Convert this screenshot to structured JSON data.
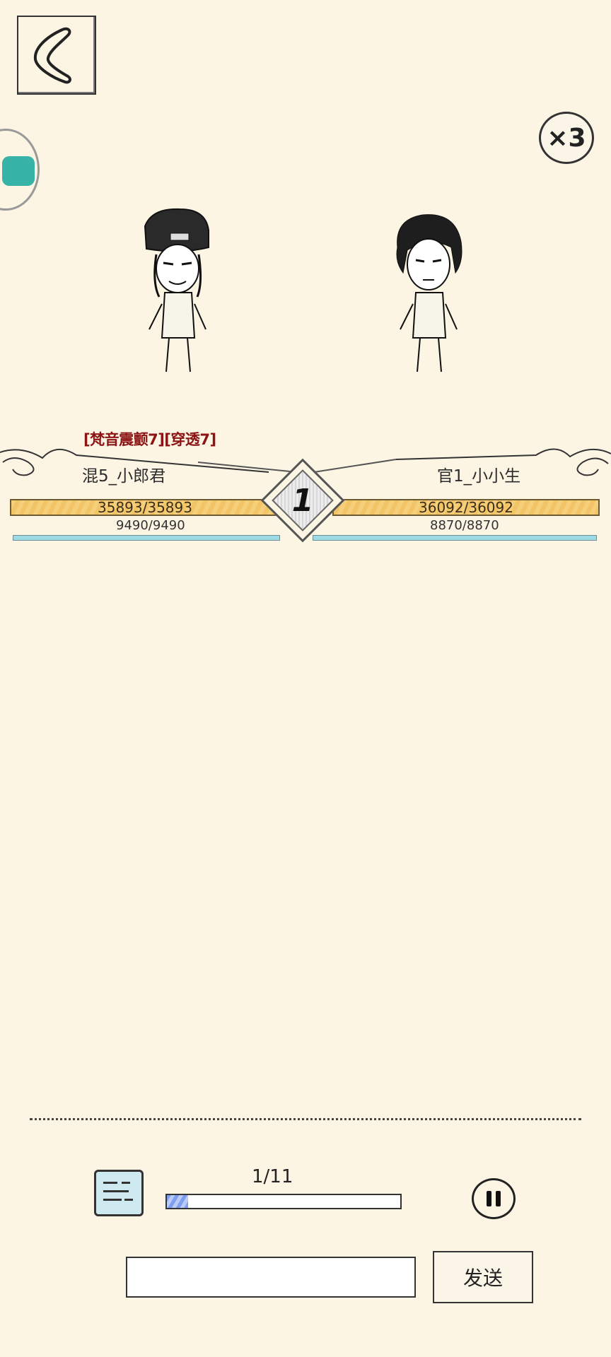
{
  "header": {
    "back_icon": "chevron-left-icon",
    "speed_label": "×3"
  },
  "battle": {
    "skill_text": "[梵音震颤7][穿透7]",
    "round_number": "1",
    "left": {
      "name": "混5_小郎君",
      "hp": "35893/35893",
      "mp": "9490/9490",
      "hp_fraction": 1.0,
      "mp_fraction": 1.0
    },
    "right": {
      "name": "官1_小小生",
      "hp": "36092/36092",
      "mp": "8870/8870",
      "hp_fraction": 1.0,
      "mp_fraction": 1.0
    }
  },
  "footer": {
    "chat_icon": "chat-bubble-icon",
    "progress_label": "1/11",
    "progress_fraction": 0.0909,
    "pause_icon": "pause-icon",
    "chat_input_value": "",
    "send_label": "发送"
  },
  "colors": {
    "background": "#fcf5e4",
    "hp_bar": "#f5cf7a",
    "mp_bar": "#9fdbe5",
    "skill_text": "#8c1414"
  }
}
